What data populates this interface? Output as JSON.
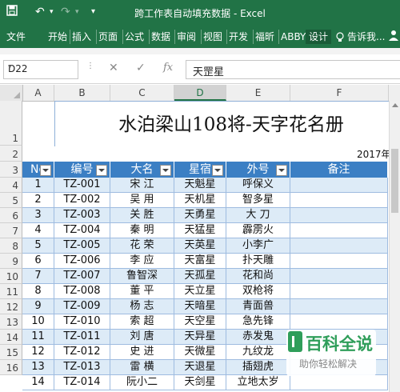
{
  "titlebar": {
    "title": "跨工作表自动填充数据 - Excel",
    "save_icon": "save-icon",
    "undo_icon": "undo-icon",
    "redo_icon": "redo-icon",
    "customize_icon": "customize-toolbar-icon"
  },
  "ribbon": {
    "tabs": [
      "文件",
      "开始",
      "插入",
      "页面",
      "公式",
      "数据",
      "审阅",
      "视图",
      "开发",
      "福昕",
      "ABBY",
      "设计"
    ],
    "active_tab": "设计",
    "tellme": "告诉我...",
    "accent_color": "#217346"
  },
  "formula_bar": {
    "name_box": "D22",
    "cancel_icon": "cancel-icon",
    "enter_icon": "enter-icon",
    "fx_label": "fx",
    "formula": "天罡星"
  },
  "columns": [
    "A",
    "B",
    "C",
    "D",
    "E",
    "F"
  ],
  "selected_column": "D",
  "rows": [
    "1",
    "2",
    "3",
    "4",
    "5",
    "6",
    "7",
    "8",
    "9",
    "10",
    "11",
    "12",
    "13",
    "14",
    "15",
    "16"
  ],
  "sheet": {
    "title": "水泊梁山108将-天字花名册",
    "year_fragment": "2017年",
    "headers": [
      "No",
      "编号",
      "大名",
      "星宿",
      "外号",
      "备注"
    ],
    "header_color": "#3b7fc4",
    "band_color": "#ddebf7",
    "data": [
      [
        "1",
        "TZ-001",
        "宋 江",
        "天魁星",
        "呼保义",
        ""
      ],
      [
        "2",
        "TZ-002",
        "吴 用",
        "天机星",
        "智多星",
        ""
      ],
      [
        "3",
        "TZ-003",
        "关 胜",
        "天勇星",
        "大 刀",
        ""
      ],
      [
        "4",
        "TZ-004",
        "秦 明",
        "天猛星",
        "霹雳火",
        ""
      ],
      [
        "5",
        "TZ-005",
        "花 荣",
        "天英星",
        "小李广",
        ""
      ],
      [
        "6",
        "TZ-006",
        "李 应",
        "天富星",
        "扑天雕",
        ""
      ],
      [
        "7",
        "TZ-007",
        "鲁智深",
        "天孤星",
        "花和尚",
        ""
      ],
      [
        "8",
        "TZ-008",
        "董 平",
        "天立星",
        "双枪将",
        ""
      ],
      [
        "9",
        "TZ-009",
        "杨 志",
        "天暗星",
        "青面兽",
        ""
      ],
      [
        "10",
        "TZ-010",
        "索 超",
        "天空星",
        "急先锋",
        ""
      ],
      [
        "11",
        "TZ-011",
        "刘 唐",
        "天异星",
        "赤发鬼",
        ""
      ],
      [
        "12",
        "TZ-012",
        "史 进",
        "天微星",
        "九纹龙",
        ""
      ],
      [
        "13",
        "TZ-013",
        "雷 横",
        "天退星",
        "插翅虎",
        ""
      ],
      [
        "14",
        "TZ-014",
        "阮小二",
        "天剑星",
        "立地太岁",
        ""
      ]
    ]
  },
  "watermark": {
    "title": "百科全说",
    "subtitle": "助你轻松解决"
  }
}
